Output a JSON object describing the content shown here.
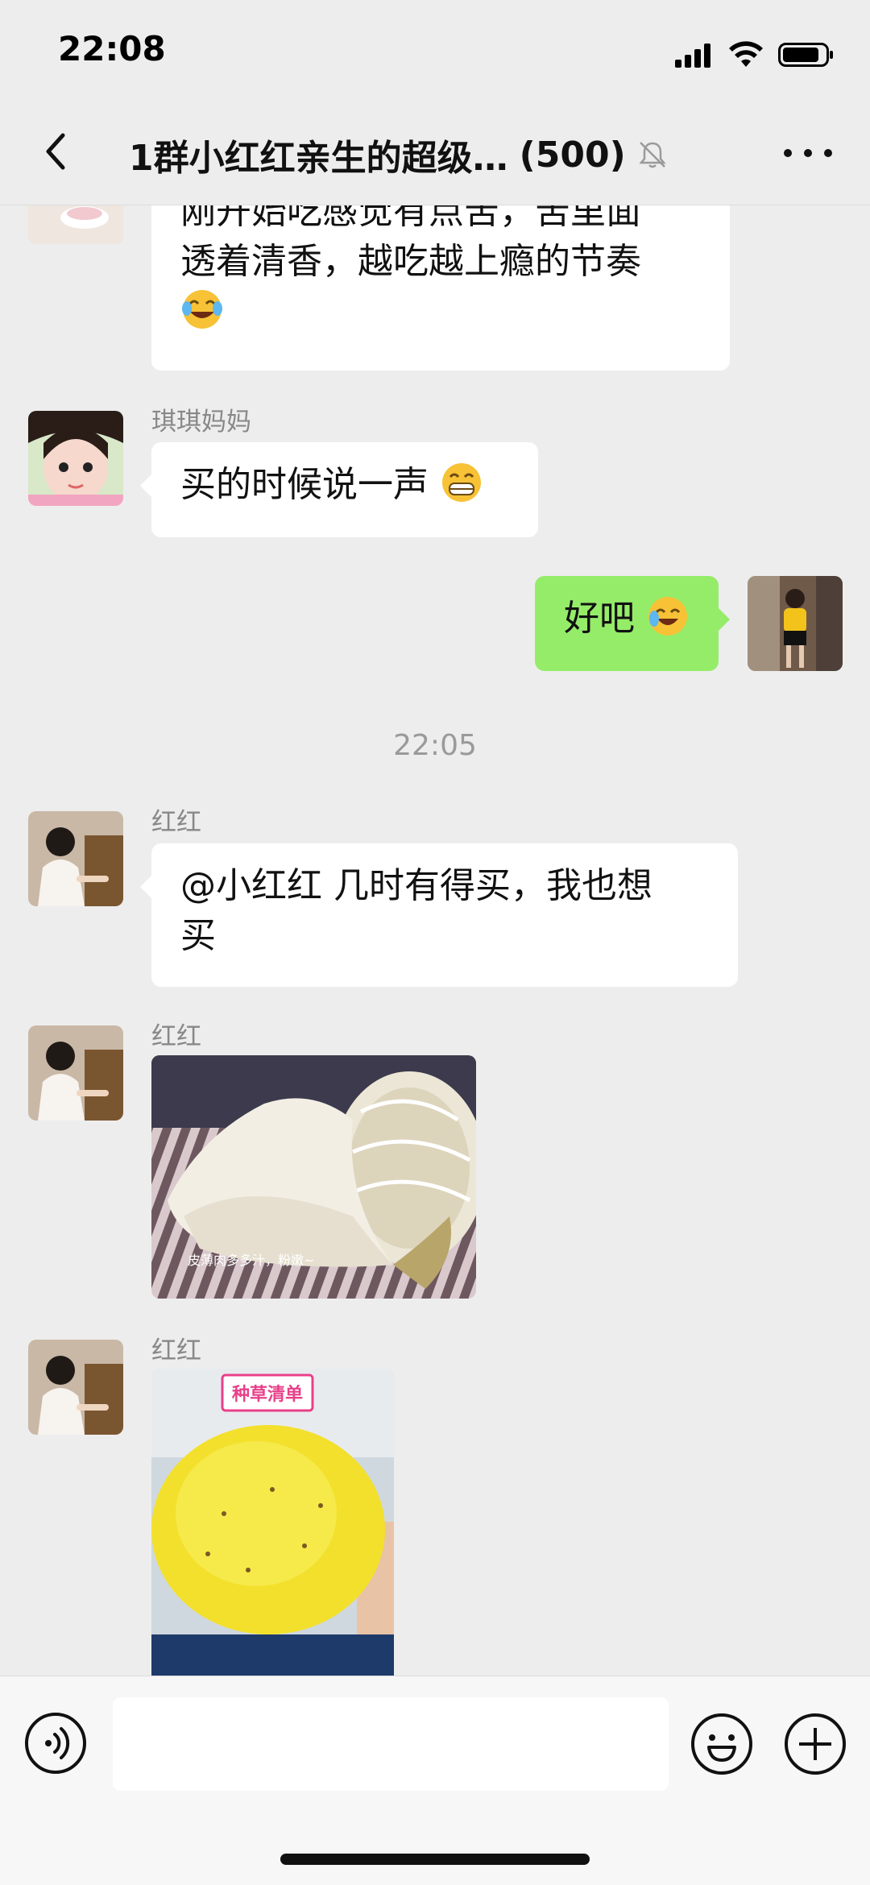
{
  "status_bar": {
    "time": "22:08"
  },
  "nav": {
    "title": "1群小红红亲生的超级…",
    "count": "(500)"
  },
  "messages": {
    "m1": {
      "line1": "刚开始吃感觉有点苦，苦里面",
      "line2": "透着清香，越吃越上瘾的节奏"
    },
    "m2": {
      "sender": "琪琪妈妈",
      "text": "买的时候说一声"
    },
    "m3": {
      "text": "好吧"
    },
    "time_divider": "22:05",
    "m4": {
      "sender": "红红",
      "line1": "@小红红 几时有得买，我也想",
      "line2": "买"
    },
    "m5": {
      "sender": "红红",
      "caption": "皮薄肉多多汁，粉嫩~"
    },
    "m6": {
      "sender": "红红",
      "badge": "种草清单"
    }
  },
  "colors": {
    "background": "#ededed",
    "self_bubble": "#95ec69",
    "other_bubble": "#ffffff"
  },
  "icons": [
    "back-arrow-icon",
    "mute-bell-icon",
    "more-icon",
    "signal-icon",
    "wifi-icon",
    "battery-icon",
    "voice-icon",
    "emoji-icon",
    "plus-icon"
  ]
}
